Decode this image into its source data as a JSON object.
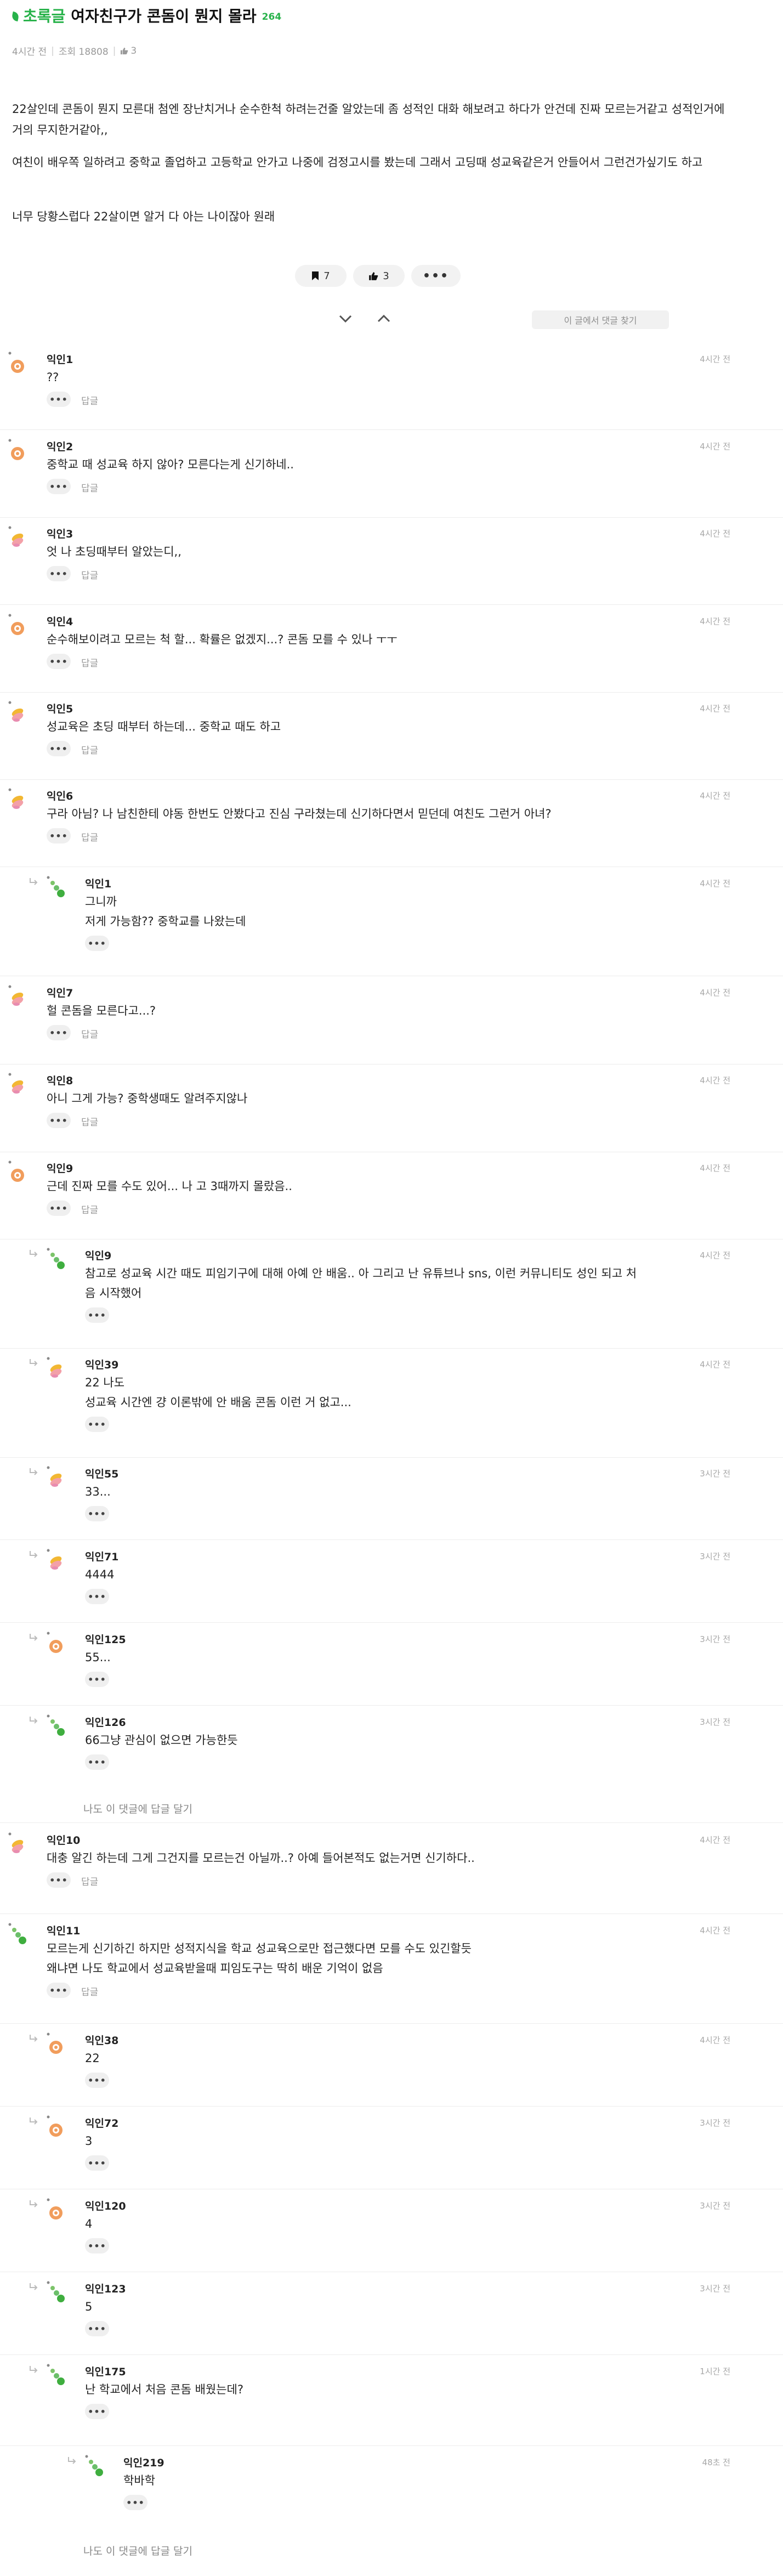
{
  "header": {
    "board": "초록글",
    "title": "여자친구가 콘돔이 뭔지 몰라",
    "comment_count": "264",
    "time_ago": "4시간 전",
    "views": "조회 18808",
    "likes": "3"
  },
  "body": [
    "22살인데 콘돔이 뭔지 모른대 첨엔 장난치거나 순수한척 하려는건줄 알았는데 좀 성적인 대화 해보려고 하다가 안건데 진짜 모르는거같고 성적인거에 거의 무지한거같아,,",
    "여친이 배우쪽 일하려고 중학교 졸업하고 고등학교 안가고 나중에 검정고시를 봤는데 그래서 고딩때 성교육같은거 안들어서 그런건가싶기도 하고",
    "너무 당황스럽다 22살이면 알거 다 아는 나이잖아 원래"
  ],
  "actions": {
    "bookmarks": "7",
    "likes": "3",
    "more": "•••"
  },
  "find_comment_label": "이 글에서 댓글 찾기",
  "ui": {
    "reply_label": "답글",
    "more_dots": "•••",
    "reply_to_this": "나도 이 댓글에 답글 달기"
  },
  "comments": [
    {
      "nick": "익인1",
      "time": "4시간 전",
      "text": "??"
    },
    {
      "nick": "익인2",
      "time": "4시간 전",
      "text": "중학교 때 성교육 하지 않아? 모른다는게 신기하네.."
    },
    {
      "nick": "익인3",
      "time": "4시간 전",
      "text": "엇 나 초딩때부터 알았는디,,"
    },
    {
      "nick": "익인4",
      "time": "4시간 전",
      "text": "순수해보이려고 모르는 척 할... 확률은 없겠지...? 콘돔 모를 수 있나 ㅜㅜ"
    },
    {
      "nick": "익인5",
      "time": "4시간 전",
      "text": "성교육은 초딩 때부터 하는데... 중학교 때도 하고"
    },
    {
      "nick": "익인6",
      "time": "4시간 전",
      "text": "구라 아님? 나 남친한테 야동 한번도 안봤다고 진심 구라쳤는데 신기하다면서 믿던데 여친도 그런거 아녀?"
    },
    {
      "nick": "익인1",
      "time": "4시간 전",
      "text": "그니까",
      "text2": "저게 가능함?? 중학교를 나왔는데"
    },
    {
      "nick": "익인7",
      "time": "4시간 전",
      "text": "헐 콘돔을 모른다고...?"
    },
    {
      "nick": "익인8",
      "time": "4시간 전",
      "text": "아니 그게 가능? 중학생때도 알려주지않나"
    },
    {
      "nick": "익인9",
      "time": "4시간 전",
      "text": "근데 진짜 모를 수도 있어... 나 고 3때까지 몰랐음.."
    },
    {
      "nick": "익인9",
      "time": "4시간 전",
      "text": "참고로 성교육 시간 때도 피임기구에 대해 아예 안 배움.. 아 그리고 난 유튜브나 sns, 이런 커뮤니티도 성인 되고 처",
      "text2": "음 시작했어"
    },
    {
      "nick": "익인39",
      "time": "4시간 전",
      "text": "22 나도",
      "text2": "성교육 시간엔 걍 이론밖에 안 배움 콘돔 이런 거 없고..."
    },
    {
      "nick": "익인55",
      "time": "3시간 전",
      "text": "33..."
    },
    {
      "nick": "익인71",
      "time": "3시간 전",
      "text": "4444"
    },
    {
      "nick": "익인125",
      "time": "3시간 전",
      "text": "55..."
    },
    {
      "nick": "익인126",
      "time": "3시간 전",
      "text": "66그냥 관심이 없으면 가능한듯"
    },
    {
      "nick": "익인10",
      "time": "4시간 전",
      "text": "대충 알긴 하는데 그게 그건지를 모르는건 아닐까..? 아예 들어본적도 없는거면 신기하다.."
    },
    {
      "nick": "익인11",
      "time": "4시간 전",
      "text": "모르는게 신기하긴 하지만 성적지식을 학교 성교육으로만 접근했다면 모를 수도 있긴할듯",
      "text2": "왜냐면 나도 학교에서 성교육받을때 피임도구는 딱히 배운 기억이 없음"
    },
    {
      "nick": "익인38",
      "time": "4시간 전",
      "text": "22"
    },
    {
      "nick": "익인72",
      "time": "3시간 전",
      "text": "3"
    },
    {
      "nick": "익인120",
      "time": "3시간 전",
      "text": "4"
    },
    {
      "nick": "익인123",
      "time": "3시간 전",
      "text": "5"
    },
    {
      "nick": "익인175",
      "time": "1시간 전",
      "text": "난 학교에서 처음 콘돔 배웠는데?"
    },
    {
      "nick": "익인219",
      "time": "48초 전",
      "text": "학바학"
    }
  ]
}
